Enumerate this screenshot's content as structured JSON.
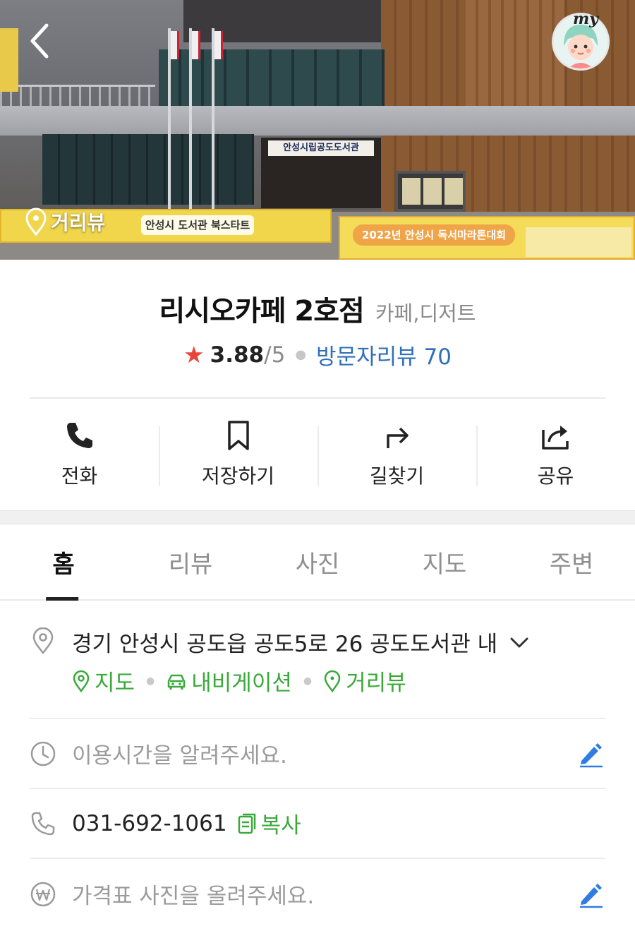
{
  "hero": {
    "building_sign": "안성시립공도도서관",
    "banner_left": "안성시 도서관 북스타트",
    "banner_right": "2022년 안성시 독서마라톤대회",
    "street_view_label": "거리뷰",
    "my_label": "my"
  },
  "place": {
    "name": "리시오카페 2호점",
    "category": "카페,디저트",
    "rating": "3.88",
    "rating_max": "/5",
    "review_link": "방문자리뷰 70"
  },
  "actions": [
    {
      "label": "전화",
      "icon": "phone-icon"
    },
    {
      "label": "저장하기",
      "icon": "bookmark-icon"
    },
    {
      "label": "길찾기",
      "icon": "directions-icon"
    },
    {
      "label": "공유",
      "icon": "share-icon"
    }
  ],
  "tabs": [
    "홈",
    "리뷰",
    "사진",
    "지도",
    "주변"
  ],
  "info": {
    "address": "경기 안성시 공도읍 공도5로 26 공도도서관 내",
    "links": [
      "지도",
      "내비게이션",
      "거리뷰"
    ],
    "hours_placeholder": "이용시간을 알려주세요.",
    "phone": "031-692-1061",
    "copy_label": "복사",
    "price_placeholder": "가격표 사진을 올려주세요."
  },
  "colors": {
    "accent_green": "#3aa93a",
    "link_blue": "#2f6fb8",
    "star_red": "#e8453c",
    "edit_blue": "#2f7de1"
  }
}
